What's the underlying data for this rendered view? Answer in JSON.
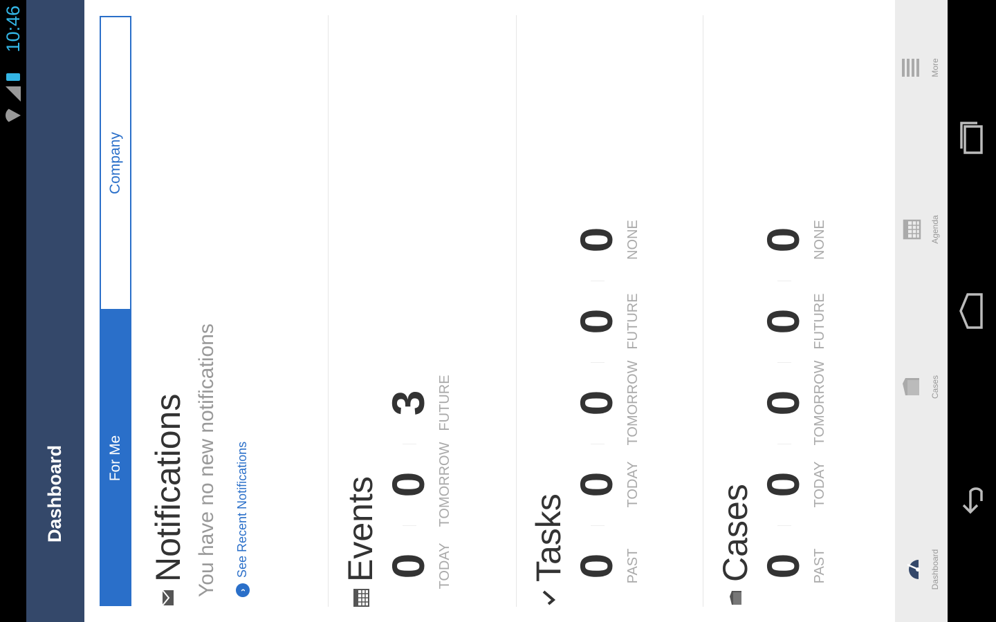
{
  "status_bar": {
    "time": "10:46"
  },
  "action_bar": {
    "title": "Dashboard"
  },
  "segments": {
    "active": "For Me",
    "inactive": "Company"
  },
  "notifications": {
    "title": "Notifications",
    "message": "You have no new notifications",
    "link": "See Recent Notifications"
  },
  "events": {
    "title": "Events",
    "stats": [
      {
        "value": "0",
        "label": "TODAY"
      },
      {
        "value": "0",
        "label": "TOMORROW"
      },
      {
        "value": "3",
        "label": "FUTURE"
      }
    ]
  },
  "tasks": {
    "title": "Tasks",
    "stats": [
      {
        "value": "0",
        "label": "PAST"
      },
      {
        "value": "0",
        "label": "TODAY"
      },
      {
        "value": "0",
        "label": "TOMORROW"
      },
      {
        "value": "0",
        "label": "FUTURE"
      },
      {
        "value": "0",
        "label": "NONE"
      }
    ]
  },
  "cases": {
    "title": "Cases",
    "stats": [
      {
        "value": "0",
        "label": "PAST"
      },
      {
        "value": "0",
        "label": "TODAY"
      },
      {
        "value": "0",
        "label": "TOMORROW"
      },
      {
        "value": "0",
        "label": "FUTURE"
      },
      {
        "value": "0",
        "label": "NONE"
      }
    ]
  },
  "tab_bar": {
    "items": [
      {
        "label": "Dashboard",
        "icon": "dashboard-gauge-icon"
      },
      {
        "label": "Cases",
        "icon": "cases-folder-icon"
      },
      {
        "label": "Agenda",
        "icon": "agenda-calendar-icon"
      },
      {
        "label": "More",
        "icon": "menu-lines-icon"
      }
    ]
  },
  "colors": {
    "action_bar": "#34486a",
    "accent": "#2a6fc9",
    "accent_status": "#33b5e5"
  }
}
